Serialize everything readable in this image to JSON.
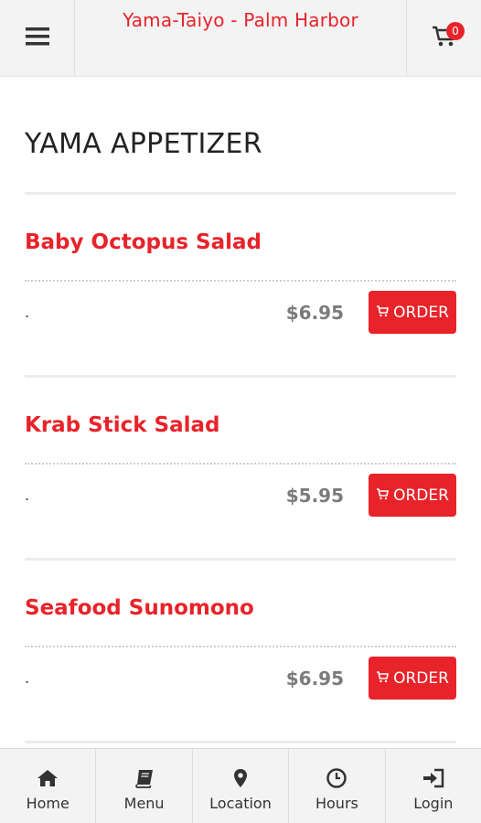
{
  "header": {
    "title": "Yama-Taiyo - Palm Harbor",
    "menu_icon": "hamburger-icon",
    "cart_icon": "cart-icon",
    "cart_count": "0"
  },
  "section": {
    "title": "YAMA APPETIZER"
  },
  "items": [
    {
      "name": "Baby Octopus Salad",
      "description": ".",
      "price": "$6.95",
      "order_label": "ORDER"
    },
    {
      "name": "Krab Stick Salad",
      "description": ".",
      "price": "$5.95",
      "order_label": "ORDER"
    },
    {
      "name": "Seafood Sunomono",
      "description": ".",
      "price": "$6.95",
      "order_label": "ORDER"
    }
  ],
  "bottom_nav": [
    {
      "label": "Home",
      "icon": "home-icon"
    },
    {
      "label": "Menu",
      "icon": "book-icon"
    },
    {
      "label": "Location",
      "icon": "map-pin-icon"
    },
    {
      "label": "Hours",
      "icon": "clock-icon"
    },
    {
      "label": "Login",
      "icon": "login-icon"
    }
  ],
  "colors": {
    "accent": "#e8232a",
    "price": "#7b7b7b",
    "header_bg": "#f3f3f3"
  }
}
